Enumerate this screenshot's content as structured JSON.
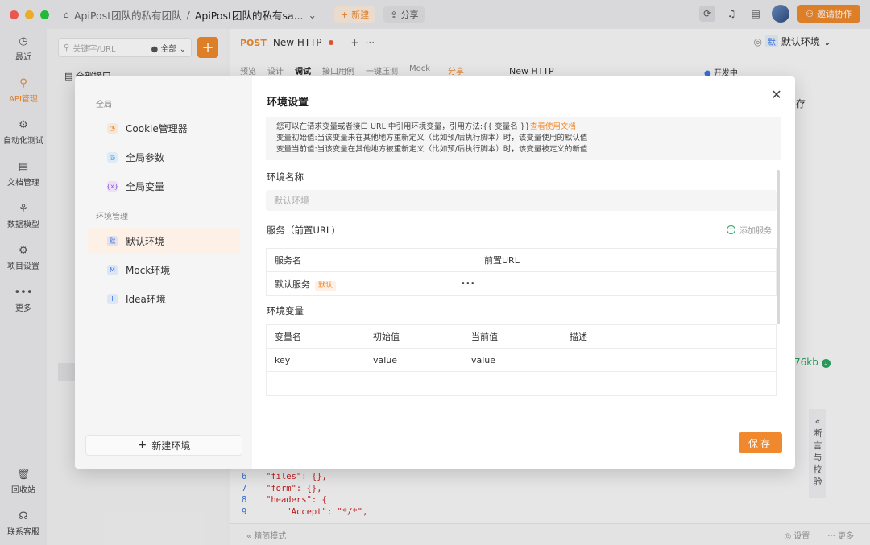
{
  "titlebar": {
    "breadcrumb_team": "ApiPost团队的私有团队",
    "breadcrumb_sep": "/",
    "breadcrumb_project": "ApiPost团队的私有sa...",
    "new_label": "新建",
    "share_label": "分享",
    "invite_label": "邀请协作"
  },
  "leftnav": [
    {
      "label": "最近",
      "icon": "clock-icon",
      "glyph": "◷"
    },
    {
      "label": "API管理",
      "icon": "link-icon",
      "glyph": "⚲"
    },
    {
      "label": "自动化测试",
      "icon": "flow-icon",
      "glyph": "⚙"
    },
    {
      "label": "文档管理",
      "icon": "doc-icon",
      "glyph": "▤"
    },
    {
      "label": "数据模型",
      "icon": "model-icon",
      "glyph": "⚘"
    },
    {
      "label": "项目设置",
      "icon": "settings-icon",
      "glyph": "⚙"
    },
    {
      "label": "更多",
      "icon": "more-icon",
      "glyph": "•••"
    },
    {
      "label": "回收站",
      "icon": "trash-icon",
      "glyph": "🗑"
    },
    {
      "label": "联系客服",
      "icon": "headset-icon",
      "glyph": "☊"
    }
  ],
  "background": {
    "search_placeholder": "关键字/URL",
    "filter_all": "全部",
    "tree_root": "全部接口",
    "tab_method": "POST",
    "tab_title": "New HTTP",
    "env_badge": "默",
    "env_name": "默认环境",
    "subtabs": [
      "预览",
      "设计",
      "调试",
      "接口用例",
      "一键压测",
      "Mock"
    ],
    "subtab_share": "分享",
    "subtab_name": "New HTTP",
    "dev_status": "开发中",
    "save_short": "存",
    "response_size": "76kb",
    "assert_label": "断言与校验",
    "code_lines": [
      {
        "n": "6",
        "text": "\"files\": {},"
      },
      {
        "n": "7",
        "text": "\"form\": {},"
      },
      {
        "n": "8",
        "text": "\"headers\": {"
      },
      {
        "n": "9",
        "text": "    \"Accept\": \"*/*\","
      }
    ],
    "footer_left": "精简模式",
    "footer_settings": "设置",
    "footer_more": "更多"
  },
  "modal": {
    "global_section": "全局",
    "global_items": [
      {
        "label": "Cookie管理器",
        "icon": "cookie-icon",
        "glyph": "◔",
        "color": "#f0892d"
      },
      {
        "label": "全局参数",
        "icon": "params-icon",
        "glyph": "◎",
        "color": "#3b9ee7"
      },
      {
        "label": "全局变量",
        "icon": "variable-icon",
        "glyph": "{x}",
        "color": "#9a5be0"
      }
    ],
    "env_section": "环境管理",
    "env_items": [
      {
        "label": "默认环境",
        "glyph": "默",
        "color": "#3b78e7"
      },
      {
        "label": "Mock环境",
        "glyph": "M",
        "color": "#3b78e7"
      },
      {
        "label": "Idea环境",
        "glyph": "I",
        "color": "#3b78e7"
      }
    ],
    "new_env_label": "新建环境",
    "title": "环境设置",
    "tips_line1": "您可以在请求变量或者接口 URL 中引用环境变量，引用方法:{{ 变量名 }}",
    "tips_link": "查看使用文档",
    "tips_line2": "变量初始值:当该变量未在其他地方重新定义（比如预/后执行脚本）时，该变量使用的默认值",
    "tips_line3": "变量当前值:当该变量在其他地方被重新定义（比如预/后执行脚本）时，该变量被定义的新值",
    "env_name_label": "环境名称",
    "env_name_placeholder": "默认环境",
    "service_label": "服务（前置URL)",
    "add_service_label": "添加服务",
    "service_headers": [
      "服务名",
      "前置URL"
    ],
    "service_rows": [
      {
        "name": "默认服务",
        "badge": "默认",
        "url": "",
        "more": "•••"
      }
    ],
    "var_label": "环境变量",
    "var_headers": [
      "变量名",
      "初始值",
      "当前值",
      "描述"
    ],
    "var_rows": [
      {
        "name": "key",
        "initial": "value",
        "current": "value",
        "desc": ""
      }
    ],
    "save_label": "保存"
  },
  "colors": {
    "accent": "#f0892d",
    "success": "#2aa564",
    "link": "#3b78e7"
  }
}
